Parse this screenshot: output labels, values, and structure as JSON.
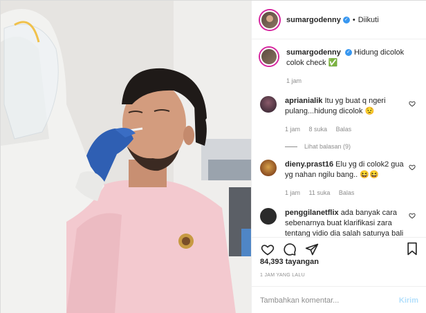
{
  "header": {
    "username": "sumargodenny",
    "separator": "•",
    "follow_status": "Diikuti"
  },
  "caption": {
    "username": "sumargodenny",
    "text": "Hidung dicolok colok check",
    "emoji": "✅",
    "time": "1 jam"
  },
  "comments": [
    {
      "username": "aprianialik",
      "text": "Itu yg buat q ngeri pulang...hidung dicolok",
      "emoji": "😟",
      "time": "1 jam",
      "likes": "8 suka",
      "reply": "Balas",
      "view_replies": "Lihat balasan (9)"
    },
    {
      "username": "dieny.prast16",
      "text": "Elu yg di colok2 gua yg nahan ngilu bang..",
      "emoji": "😆😆",
      "time": "1 jam",
      "likes": "11 suka",
      "reply": "Balas"
    },
    {
      "username": "penggilanetflix",
      "text": "ada banyak cara sebenarnya buat klarifikasi zara tentang vidio dia salah satunya bali netflix terus nonton drakor"
    }
  ],
  "stats": {
    "views": "84,393 tayangan",
    "posted": "1 JAM YANG LALU"
  },
  "comment_box": {
    "placeholder": "Tambahkan komentar...",
    "post_label": "Kirim"
  },
  "colors": {
    "accent": "#3897f0",
    "muted": "#8e8e8e",
    "post_disabled": "#b2dffc"
  },
  "icons": [
    "verified-icon",
    "heart-icon",
    "comment-icon",
    "share-icon",
    "bookmark-icon"
  ]
}
